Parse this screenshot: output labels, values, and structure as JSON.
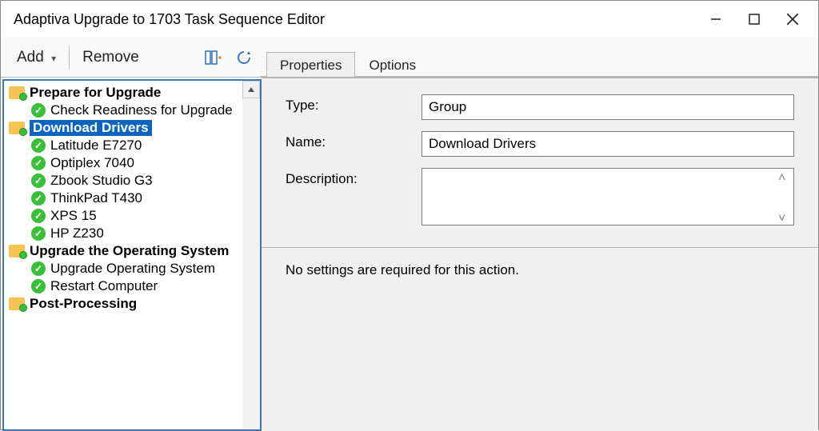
{
  "window": {
    "title": "Adaptiva Upgrade to 1703 Task Sequence Editor"
  },
  "toolbar": {
    "add_label": "Add",
    "remove_label": "Remove"
  },
  "tabs": {
    "properties": "Properties",
    "options": "Options"
  },
  "tree": {
    "groups": [
      {
        "label": "Prepare for Upgrade",
        "steps": [
          {
            "label": "Check Readiness for Upgrade"
          }
        ]
      },
      {
        "label": "Download Drivers",
        "selected": true,
        "steps": [
          {
            "label": "Latitude E7270"
          },
          {
            "label": "Optiplex 7040"
          },
          {
            "label": "Zbook Studio G3"
          },
          {
            "label": "ThinkPad T430"
          },
          {
            "label": "XPS 15"
          },
          {
            "label": "HP Z230"
          }
        ]
      },
      {
        "label": "Upgrade the Operating System",
        "truncated": true,
        "steps": [
          {
            "label": "Upgrade Operating System"
          },
          {
            "label": "Restart Computer"
          }
        ]
      },
      {
        "label": "Post-Processing",
        "steps": []
      }
    ]
  },
  "form": {
    "type_label": "Type:",
    "type_value": "Group",
    "name_label": "Name:",
    "name_value": "Download Drivers",
    "desc_label": "Description:",
    "desc_value": "",
    "info_text": "No settings are required for this action."
  }
}
